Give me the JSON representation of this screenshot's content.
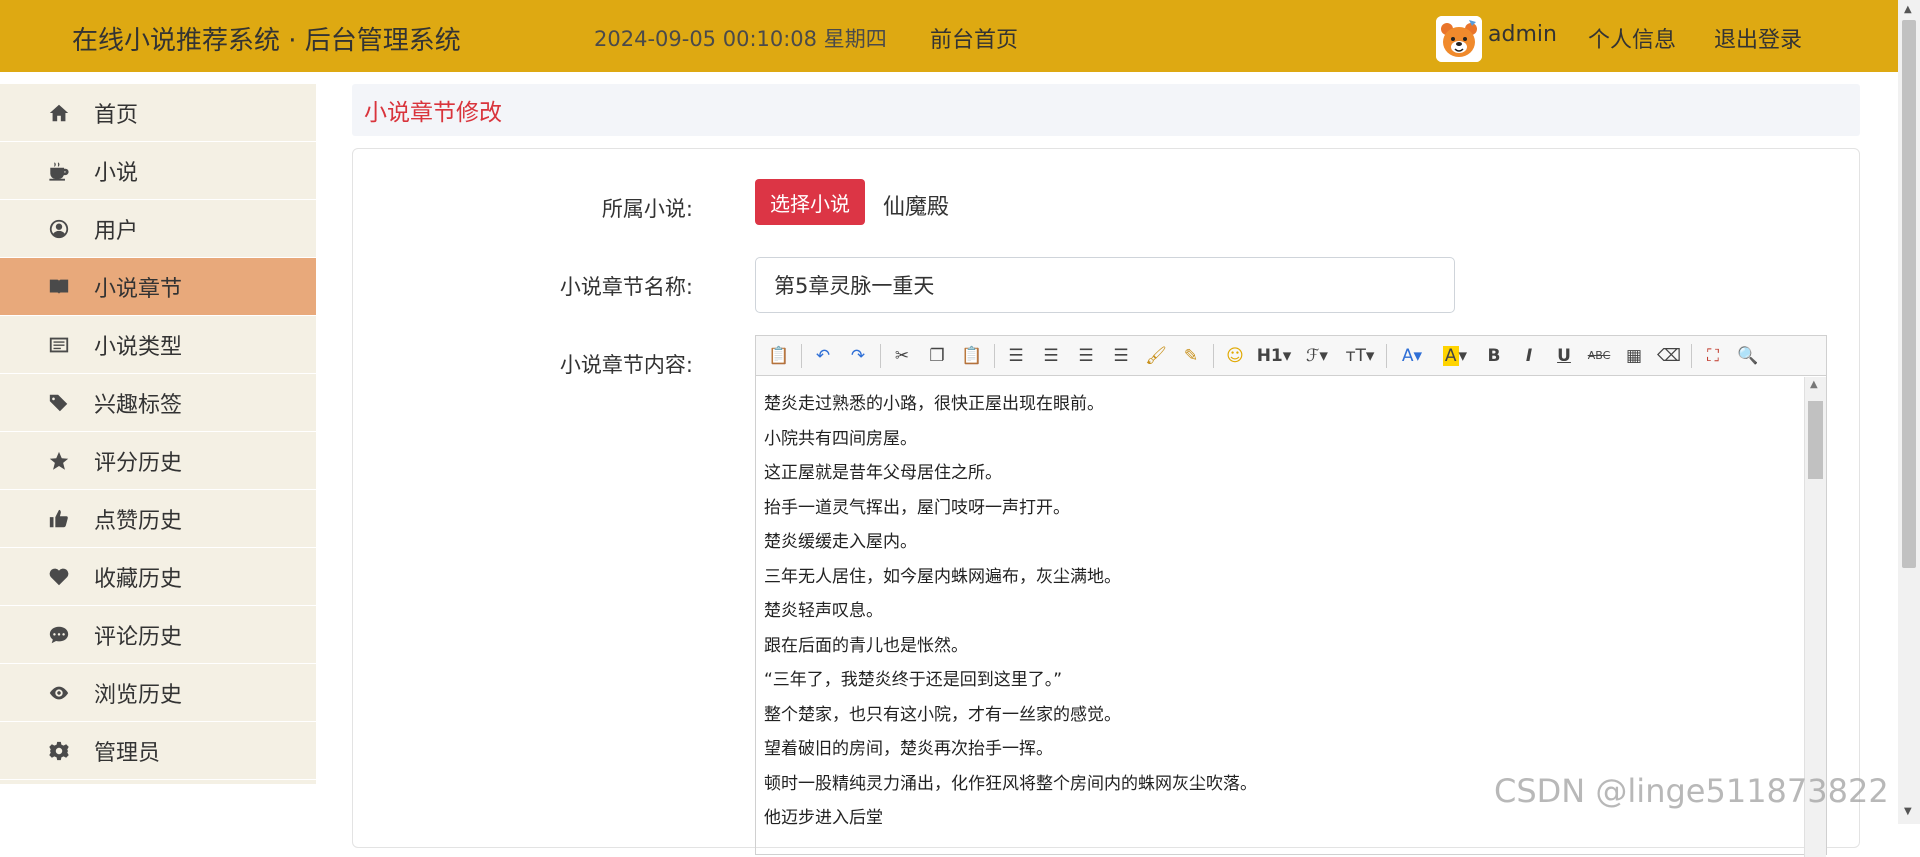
{
  "header": {
    "brand": "在线小说推荐系统 · 后台管理系统",
    "clock": "2024-09-05  00:10:08  星期四",
    "front_link": "前台首页",
    "user_name": "admin",
    "profile_link": "个人信息",
    "logout_link": "退出登录",
    "bar_color": "#dea912"
  },
  "sidebar": {
    "items": [
      {
        "label": "首页",
        "icon": "home-icon"
      },
      {
        "label": "小说",
        "icon": "coffee-cup-icon"
      },
      {
        "label": "用户",
        "icon": "user-circle-icon"
      },
      {
        "label": "小说章节",
        "icon": "book-open-icon",
        "active": true
      },
      {
        "label": "小说类型",
        "icon": "list-icon"
      },
      {
        "label": "兴趣标签",
        "icon": "tags-icon"
      },
      {
        "label": "评分历史",
        "icon": "star-icon"
      },
      {
        "label": "点赞历史",
        "icon": "thumbs-up-icon"
      },
      {
        "label": "收藏历史",
        "icon": "heart-icon"
      },
      {
        "label": "评论历史",
        "icon": "comment-icon"
      },
      {
        "label": "浏览历史",
        "icon": "eye-icon"
      },
      {
        "label": "管理员",
        "icon": "gear-icon"
      }
    ],
    "active_color": "#e8a97b"
  },
  "main": {
    "page_title": "小说章节修改",
    "form": {
      "novel_label": "所属小说:",
      "select_button": "选择小说",
      "novel_name": "仙魔殿",
      "chapter_name_label": "小说章节名称:",
      "chapter_name_value": "第5章灵脉一重天",
      "content_label": "小说章节内容:"
    },
    "editor": {
      "toolbar": [
        "paste-icon",
        "undo-icon",
        "redo-icon",
        "cut-icon",
        "copy-icon",
        "paste-text-icon",
        "align-left-icon",
        "align-center-icon",
        "align-right-icon",
        "align-justify-icon",
        "format-brush-icon",
        "format-clear-text-icon",
        "emoji-icon",
        "heading-icon",
        "font-family-icon",
        "font-size-icon",
        "font-color-icon",
        "highlight-icon",
        "bold-icon",
        "italic-icon",
        "underline-icon",
        "strikethrough-icon",
        "table-icon",
        "eraser-icon",
        "fullscreen-icon",
        "preview-icon"
      ],
      "toolbar_text": {
        "heading": "H1",
        "bold": "B",
        "italic": "I",
        "underline": "U",
        "strike": "ABC"
      },
      "lines": [
        "楚炎走过熟悉的小路，很快正屋出现在眼前。",
        "小院共有四间房屋。",
        "这正屋就是昔年父母居住之所。",
        "抬手一道灵气挥出，屋门吱呀一声打开。",
        "楚炎缓缓走入屋内。",
        "三年无人居住，如今屋内蛛网遍布，灰尘满地。",
        "楚炎轻声叹息。",
        "跟在后面的青儿也是怅然。",
        "“三年了，我楚炎终于还是回到这里了。”",
        "整个楚家，也只有这小院，才有一丝家的感觉。",
        "望着破旧的房间，楚炎再次抬手一挥。",
        "顿时一股精纯灵力涌出，化作狂风将整个房间内的蛛网灰尘吹落。",
        "他迈步进入后堂"
      ]
    }
  },
  "watermark": "CSDN @linge511873822"
}
